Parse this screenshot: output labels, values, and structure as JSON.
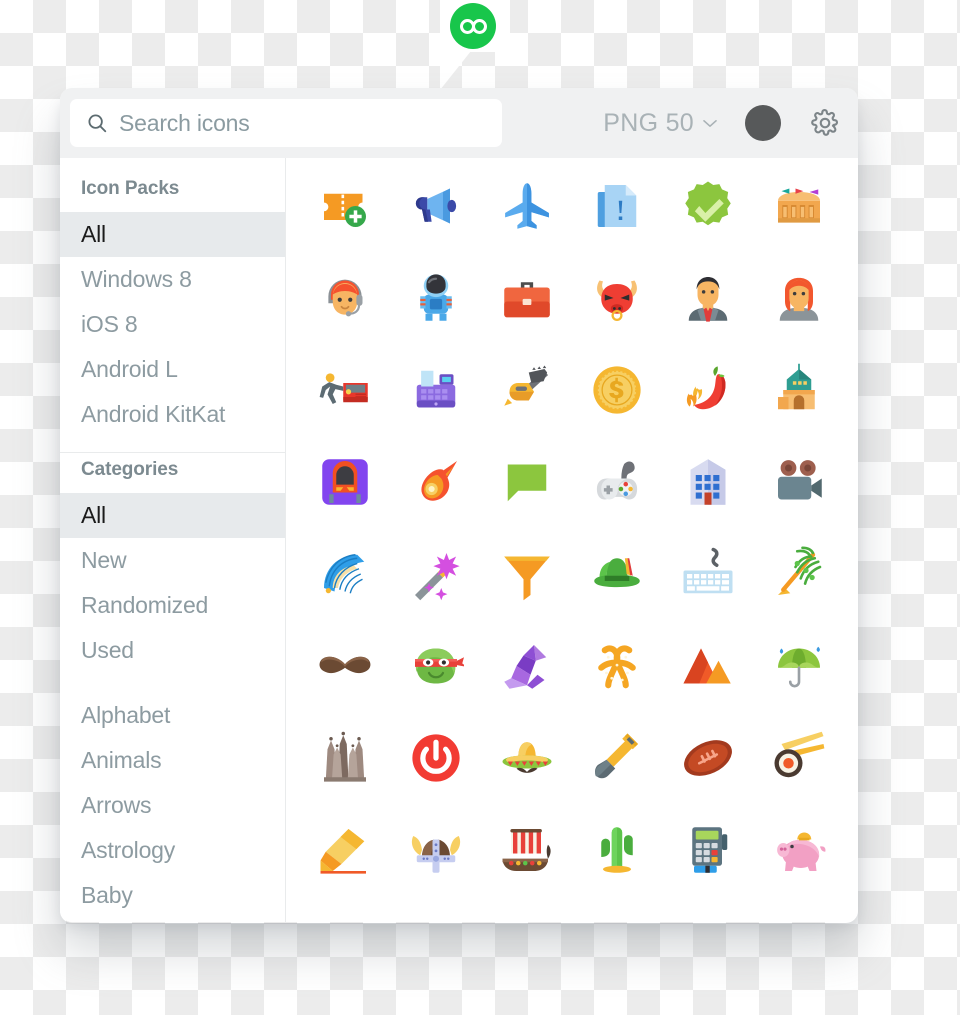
{
  "app": {
    "logo_icon": "infinity-badge-icon"
  },
  "header": {
    "search": {
      "icon": "search-icon",
      "value": "",
      "placeholder": "Search icons"
    },
    "format": {
      "label": "PNG 50",
      "chevron_icon": "chevron-down-icon",
      "options": [
        "PNG 50"
      ]
    },
    "color_swatch": {
      "icon": "color-swatch-icon",
      "color": "#57595a"
    },
    "settings": {
      "icon": "gear-icon"
    }
  },
  "sidebar": {
    "groups": [
      {
        "heading": "Icon Packs",
        "items": [
          {
            "label": "All",
            "selected": true
          },
          {
            "label": "Windows 8",
            "selected": false
          },
          {
            "label": "iOS 8",
            "selected": false
          },
          {
            "label": "Android L",
            "selected": false
          },
          {
            "label": "Android KitKat",
            "selected": false
          }
        ]
      },
      {
        "heading": "Categories",
        "items": [
          {
            "label": "All",
            "selected": true
          },
          {
            "label": "New",
            "selected": false
          },
          {
            "label": "Randomized",
            "selected": false
          },
          {
            "label": "Used",
            "selected": false
          },
          {
            "label": "Alphabet",
            "selected": false,
            "gap_before": true
          },
          {
            "label": "Animals",
            "selected": false
          },
          {
            "label": "Arrows",
            "selected": false
          },
          {
            "label": "Astrology",
            "selected": false
          },
          {
            "label": "Baby",
            "selected": false
          }
        ]
      }
    ]
  },
  "grid": {
    "columns": 6,
    "icons": [
      {
        "name": "add-ticket-icon"
      },
      {
        "name": "megaphone-icon"
      },
      {
        "name": "airplane-icon"
      },
      {
        "name": "document-alert-icon"
      },
      {
        "name": "verified-badge-icon"
      },
      {
        "name": "colosseum-icon"
      },
      {
        "name": "support-agent-icon"
      },
      {
        "name": "astronaut-icon"
      },
      {
        "name": "briefcase-icon"
      },
      {
        "name": "bull-icon"
      },
      {
        "name": "businessman-icon"
      },
      {
        "name": "woman-icon"
      },
      {
        "name": "car-push-icon"
      },
      {
        "name": "cash-register-icon"
      },
      {
        "name": "chainsaw-icon"
      },
      {
        "name": "dollar-coin-icon"
      },
      {
        "name": "chili-pepper-icon"
      },
      {
        "name": "church-icon"
      },
      {
        "name": "train-icon"
      },
      {
        "name": "comet-icon"
      },
      {
        "name": "chat-bubble-icon"
      },
      {
        "name": "gamepad-icon"
      },
      {
        "name": "office-building-icon"
      },
      {
        "name": "video-camera-icon"
      },
      {
        "name": "hand-fan-icon"
      },
      {
        "name": "magic-wand-icon"
      },
      {
        "name": "funnel-icon"
      },
      {
        "name": "tyrolean-hat-icon"
      },
      {
        "name": "keyboard-icon"
      },
      {
        "name": "palm-branch-icon"
      },
      {
        "name": "mustache-icon"
      },
      {
        "name": "ninja-turtle-icon"
      },
      {
        "name": "origami-swan-icon"
      },
      {
        "name": "pretzel-icon"
      },
      {
        "name": "mountain-icon"
      },
      {
        "name": "umbrella-rain-icon"
      },
      {
        "name": "sagrada-familia-icon"
      },
      {
        "name": "power-button-icon"
      },
      {
        "name": "sombrero-icon"
      },
      {
        "name": "shovel-icon"
      },
      {
        "name": "football-icon"
      },
      {
        "name": "sushi-icon"
      },
      {
        "name": "highlighter-icon"
      },
      {
        "name": "viking-helmet-icon"
      },
      {
        "name": "viking-ship-icon"
      },
      {
        "name": "cactus-icon"
      },
      {
        "name": "card-terminal-icon"
      },
      {
        "name": "piggy-bank-icon"
      }
    ]
  },
  "colors": {
    "badge_green": "#18c64b",
    "header_bg": "#f0f1f2",
    "selected_row": "#e7eaec",
    "muted_text": "#8d9ba1"
  }
}
